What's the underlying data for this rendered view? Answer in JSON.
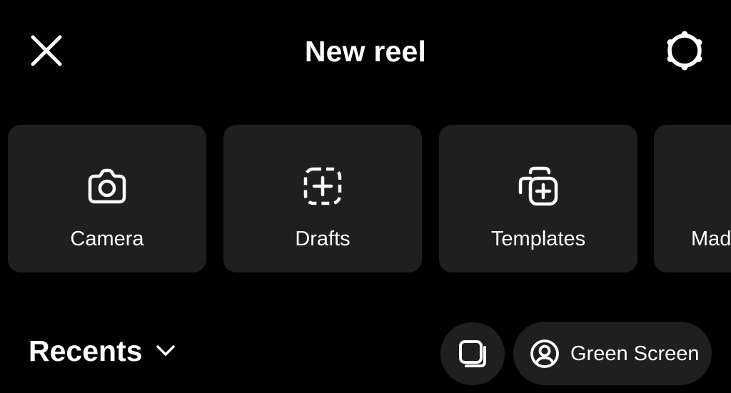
{
  "header": {
    "title": "New reel",
    "close_icon": "close-icon",
    "settings_icon": "gear-icon"
  },
  "tiles": [
    {
      "label": "Camera",
      "icon": "camera-icon"
    },
    {
      "label": "Drafts",
      "icon": "dashed-add-icon"
    },
    {
      "label": "Templates",
      "icon": "stacked-add-icon"
    },
    {
      "label": "Mad",
      "icon": ""
    }
  ],
  "gallery": {
    "recents_label": "Recents",
    "recents_icon": "chevron-down-icon",
    "multi_select_icon": "multi-select-icon",
    "green_screen_label": "Green Screen",
    "green_screen_icon": "user-circle-icon"
  },
  "colors": {
    "background": "#000000",
    "surface": "#1f1f1f",
    "text": "#ffffff"
  }
}
